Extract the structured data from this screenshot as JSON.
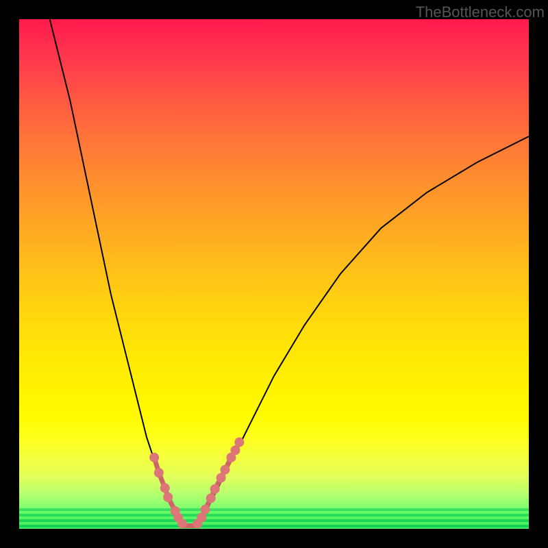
{
  "watermark": "TheBottleneck.com",
  "chart_data": {
    "type": "line",
    "title": "",
    "xlabel": "",
    "ylabel": "",
    "xlim": [
      0,
      100
    ],
    "ylim": [
      0,
      100
    ],
    "left_curve": {
      "x": [
        6,
        10,
        14,
        18,
        22,
        25,
        27,
        29,
        30.5,
        31.5,
        32.3
      ],
      "y": [
        100,
        84,
        65,
        46,
        30,
        18,
        12,
        7,
        4,
        2,
        0.5
      ]
    },
    "right_curve": {
      "x": [
        34.5,
        36,
        38,
        41,
        45,
        50,
        56,
        63,
        71,
        80,
        90,
        100
      ],
      "y": [
        0.5,
        2,
        6,
        12,
        20,
        30,
        40,
        50,
        59,
        66,
        72,
        77
      ]
    },
    "beads_left": [
      {
        "x": 26.5,
        "y": 14
      },
      {
        "x": 27.4,
        "y": 11
      },
      {
        "x": 28.6,
        "y": 8
      },
      {
        "x": 29.2,
        "y": 6.2
      },
      {
        "x": 30.6,
        "y": 3.5
      },
      {
        "x": 31.2,
        "y": 2.2
      },
      {
        "x": 32.0,
        "y": 1.0
      }
    ],
    "beads_right": [
      {
        "x": 35.0,
        "y": 1.0
      },
      {
        "x": 35.8,
        "y": 2.2
      },
      {
        "x": 36.5,
        "y": 3.8
      },
      {
        "x": 37.6,
        "y": 6.0
      },
      {
        "x": 38.4,
        "y": 7.8
      },
      {
        "x": 39.6,
        "y": 10.0
      },
      {
        "x": 40.4,
        "y": 11.6
      },
      {
        "x": 41.6,
        "y": 14.0
      },
      {
        "x": 42.4,
        "y": 15.4
      },
      {
        "x": 43.2,
        "y": 17.0
      }
    ],
    "bottom_segment": {
      "x1": 32.0,
      "y1": 0.6,
      "x2": 35.0,
      "y2": 0.6
    },
    "colors": {
      "curve": "#000000",
      "beads": "#dd7777",
      "gradient_top": "#ff1a4d",
      "gradient_bottom": "#1ad45a"
    }
  }
}
